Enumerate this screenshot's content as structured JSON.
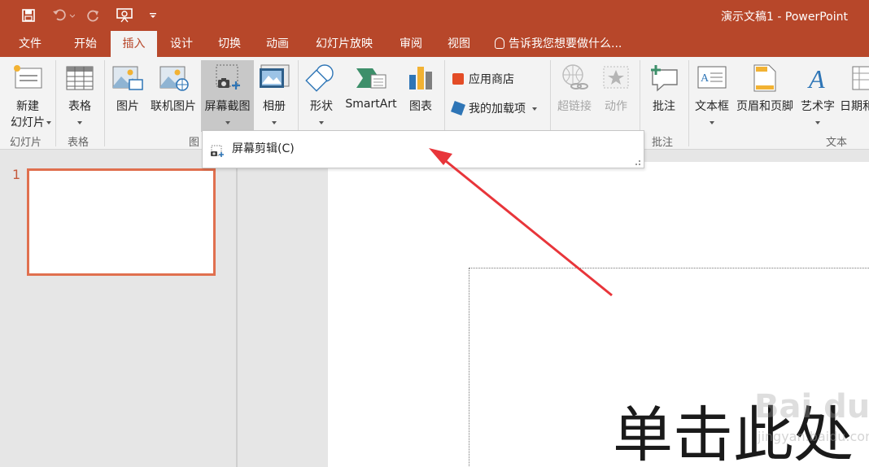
{
  "window": {
    "title": "演示文稿1 - PowerPoint"
  },
  "qat": {
    "save_icon": "save-icon",
    "undo_icon": "undo-icon",
    "redo_icon": "redo-icon",
    "present_icon": "start-from-beginning-icon",
    "customize_icon": "customize-qat-icon"
  },
  "tabs": [
    {
      "label": "文件"
    },
    {
      "label": "开始"
    },
    {
      "label": "插入"
    },
    {
      "label": "设计"
    },
    {
      "label": "切换"
    },
    {
      "label": "动画"
    },
    {
      "label": "幻灯片放映"
    },
    {
      "label": "审阅"
    },
    {
      "label": "视图"
    }
  ],
  "active_tab": "插入",
  "tell_me": "告诉我您想要做什么...",
  "ribbon": {
    "new_slide": {
      "line1": "新建",
      "line2": "幻灯片"
    },
    "table": "表格",
    "picture": "图片",
    "online_picture": "联机图片",
    "screenshot": "屏幕截图",
    "album": "相册",
    "shapes": "形状",
    "smartart": "SmartArt",
    "chart": "图表",
    "store": "应用商店",
    "my_addins": "我的加载项",
    "hyperlink": "超链接",
    "action": "动作",
    "comment": "批注",
    "textbox": "文本框",
    "header_footer": "页眉和页脚",
    "wordart": "艺术字",
    "datetime": "日期和",
    "groups": {
      "slides": "幻灯片",
      "tables": "表格",
      "images": "图",
      "comments": "批注",
      "text": "文本"
    }
  },
  "dropdown": {
    "item": "屏幕剪辑(C)"
  },
  "slides_pane": {
    "number": "1"
  },
  "slide": {
    "placeholder_text": "单击此处"
  },
  "watermark": {
    "text": "Bai du 经验",
    "sub": "jingyan.baidu.com"
  },
  "colors": {
    "accent": "#b7472a",
    "thumb_border": "#e0704f",
    "arrow": "#e8353a"
  }
}
